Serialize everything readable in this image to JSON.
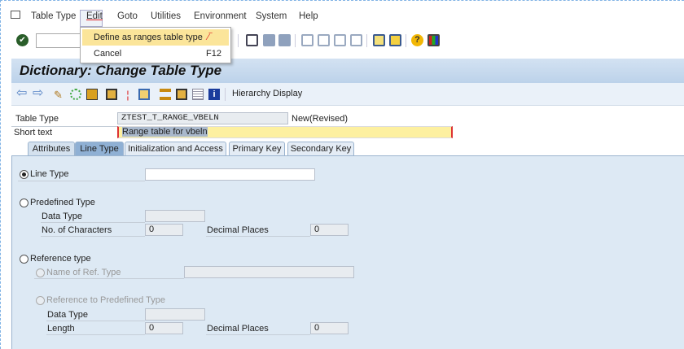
{
  "menubar": {
    "items": [
      "Table Type",
      "Edit",
      "Goto",
      "Utilities",
      "Environment",
      "System",
      "Help"
    ]
  },
  "edit_menu": {
    "items": [
      {
        "label": "Define as ranges table type",
        "shortcut": ""
      },
      {
        "label": "Cancel",
        "shortcut": "F12"
      }
    ]
  },
  "title": "Dictionary: Change Table Type",
  "app_toolbar": {
    "hierarchy_label": "Hierarchy Display"
  },
  "header": {
    "table_type_label": "Table Type",
    "table_type_value": "ZTEST_T_RANGE_VBELN",
    "status": "New(Revised)",
    "short_text_label": "Short text",
    "short_text_value": "Range table for vbeln"
  },
  "tabs": [
    "Attributes",
    "Line Type",
    "Initialization and Access",
    "Primary Key",
    "Secondary Key"
  ],
  "active_tab": "Line Type",
  "form": {
    "line_type": "Line Type",
    "line_type_value": "",
    "predefined_type": "Predefined Type",
    "data_type": "Data Type",
    "no_chars": "No. of Characters",
    "no_chars_value": "0",
    "decimal_places": "Decimal Places",
    "decimal_value": "0",
    "reference_type": "Reference type",
    "name_ref_type": "Name of Ref. Type",
    "ref_predefined": "Reference to Predefined Type",
    "data_type2": "Data Type",
    "length": "Length",
    "length_value": "0",
    "decimal_places2": "Decimal Places",
    "decimal_value2": "0"
  },
  "colors": {
    "menu_highlight": "#fbe59a",
    "short_text_bg": "#fdf0a0",
    "panel_bg": "#dde9f4"
  }
}
